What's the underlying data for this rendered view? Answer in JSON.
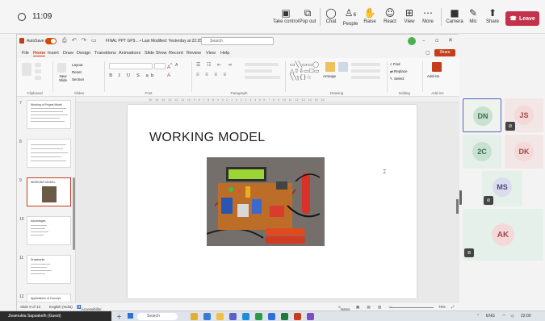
{
  "meeting": {
    "elapsed": "11:09",
    "controls": [
      {
        "label": "Take control",
        "icon": "take-control-icon",
        "glyph": "▣"
      },
      {
        "label": "Pop out",
        "icon": "pop-out-icon",
        "glyph": "⧉"
      },
      {
        "label": "Chat",
        "icon": "chat-icon",
        "glyph": "💬"
      },
      {
        "label": "People",
        "icon": "people-icon",
        "glyph": "👥"
      },
      {
        "label": "Raise",
        "icon": "raise-hand-icon",
        "glyph": "✋"
      },
      {
        "label": "React",
        "icon": "react-icon",
        "glyph": "☺"
      },
      {
        "label": "View",
        "icon": "view-icon",
        "glyph": "⊞"
      },
      {
        "label": "More",
        "icon": "more-icon",
        "glyph": "⋯"
      },
      {
        "label": "Camera",
        "icon": "camera-icon",
        "glyph": "■"
      },
      {
        "label": "Mic",
        "icon": "mic-icon",
        "glyph": "🎙"
      },
      {
        "label": "Share",
        "icon": "share-icon",
        "glyph": "⬆"
      }
    ],
    "people_count": "6",
    "leave_label": "Leave"
  },
  "ppt": {
    "autosave_label": "AutoSave",
    "filename": "FINAL PPT GP9... • Last Modified: Yesterday at 22:25",
    "search_placeholder": "Search",
    "menu": [
      "File",
      "Home",
      "Insert",
      "Draw",
      "Design",
      "Transitions",
      "Animations",
      "Slide Show",
      "Record",
      "Review",
      "View",
      "Help"
    ],
    "active_menu": "Home",
    "share_label": "Share",
    "ribbon_groups": [
      "Clipboard",
      "Slides",
      "Font",
      "Paragraph",
      "Drawing",
      "Editing",
      "Add-ins"
    ],
    "ribbon_labels": {
      "layout": "Layout",
      "reset": "Reset",
      "new_slide": "New Slide",
      "section": "Section",
      "arrange": "Arrange",
      "find": "Find",
      "replace": "Replace",
      "select": "Select",
      "addins": "Add-ins"
    },
    "thumbnails": [
      {
        "num": "7",
        "title": "Working of Project Model"
      },
      {
        "num": "8",
        "title": ""
      },
      {
        "num": "9",
        "title": "WORKING MODEL"
      },
      {
        "num": "10",
        "title": "Advantages"
      },
      {
        "num": "11",
        "title": "Drawbacks"
      },
      {
        "num": "12",
        "title": "Applications of Concept"
      }
    ],
    "selected_slide": "9",
    "slide_title": "WORKING MODEL",
    "status": {
      "slide_of": "Slide 9 of 13",
      "language": "English (India)",
      "accessibility": "Accessibility: Investigate",
      "notes": "Notes",
      "zoom": "79%"
    }
  },
  "participants": [
    {
      "initials": "DN",
      "active": true
    },
    {
      "initials": "JS"
    },
    {
      "initials": "2C"
    },
    {
      "initials": "DK"
    },
    {
      "initials": "MS"
    },
    {
      "initials": "AK"
    }
  ],
  "taskbar": {
    "presenter": "Jivamukta Sapsaketh (Guest)",
    "search_placeholder": "Search",
    "lang": "ENG",
    "time": "22:00"
  }
}
